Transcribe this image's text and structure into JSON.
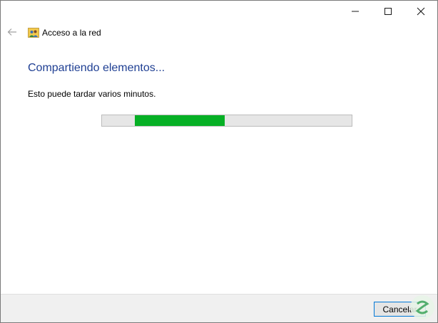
{
  "window": {
    "title": "Acceso a la red",
    "title_icon": "network-users-icon",
    "controls": {
      "minimize": "minimize-icon",
      "maximize": "maximize-icon",
      "close": "close-icon"
    },
    "back_icon": "back-arrow-icon"
  },
  "main": {
    "heading": "Compartiendo elementos...",
    "subtext": "Esto puede tardar varios minutos.",
    "progress": {
      "fill_start": 0.13,
      "fill_end": 0.49,
      "color": "#06b025",
      "track_color": "#e6e6e6"
    }
  },
  "footer": {
    "cancel_label": "Cancelar"
  },
  "colors": {
    "heading": "#1f3f93",
    "accent_border": "#0078d7",
    "footer_bg": "#f0f0f0"
  }
}
